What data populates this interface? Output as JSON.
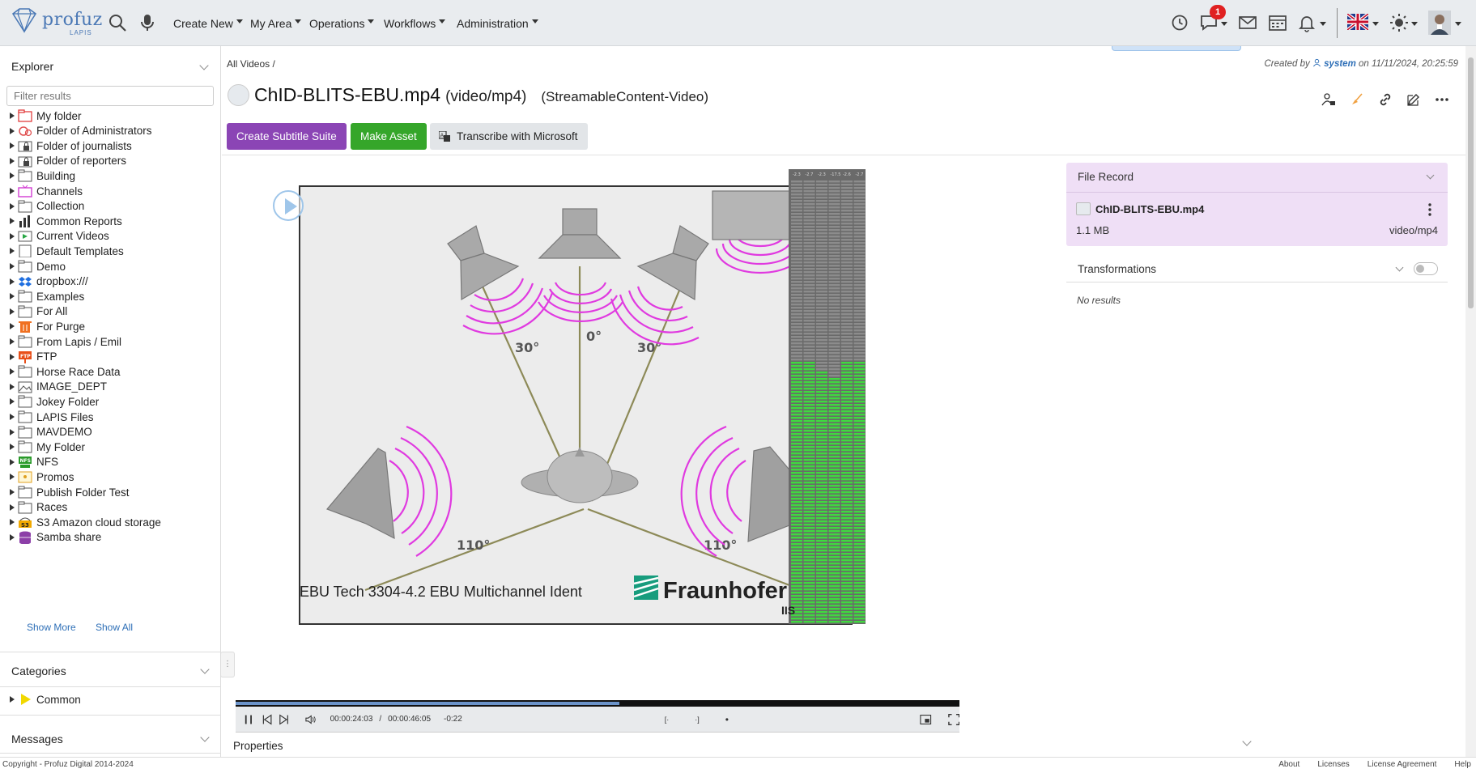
{
  "header": {
    "logo_text": "profuz",
    "logo_sub": "LAPIS",
    "menus": [
      "Create New",
      "My Area",
      "Operations",
      "Workflows",
      "Administration"
    ],
    "chat_badge": "1"
  },
  "sidebar": {
    "explorer_title": "Explorer",
    "filter_placeholder": "Filter results",
    "folders": [
      {
        "label": "My folder",
        "icon": "red-folder-icon"
      },
      {
        "label": "Folder of Administrators",
        "icon": "admin-folder-icon"
      },
      {
        "label": "Folder of journalists",
        "icon": "locked-folder-icon"
      },
      {
        "label": "Folder of reporters",
        "icon": "locked-folder-icon"
      },
      {
        "label": "Building",
        "icon": "folder-icon"
      },
      {
        "label": "Channels",
        "icon": "tv-icon"
      },
      {
        "label": "Collection",
        "icon": "folder-icon"
      },
      {
        "label": "Common Reports",
        "icon": "bar-chart-icon"
      },
      {
        "label": "Current Videos",
        "icon": "video-icon"
      },
      {
        "label": "Default Templates",
        "icon": "template-icon"
      },
      {
        "label": "Demo",
        "icon": "folder-icon"
      },
      {
        "label": "dropbox:///",
        "icon": "dropbox-icon"
      },
      {
        "label": "Examples",
        "icon": "folder-icon"
      },
      {
        "label": "For All",
        "icon": "folder-icon"
      },
      {
        "label": "For Purge",
        "icon": "trash-icon"
      },
      {
        "label": "From Lapis / Emil",
        "icon": "folder-icon"
      },
      {
        "label": "FTP",
        "icon": "ftp-icon"
      },
      {
        "label": "Horse Race Data",
        "icon": "folder-icon"
      },
      {
        "label": "IMAGE_DEPT",
        "icon": "image-icon"
      },
      {
        "label": "Jokey Folder",
        "icon": "folder-icon"
      },
      {
        "label": "LAPIS Files",
        "icon": "folder-icon"
      },
      {
        "label": "MAVDEMO",
        "icon": "folder-icon"
      },
      {
        "label": "My Folder",
        "icon": "folder-icon"
      },
      {
        "label": "NFS",
        "icon": "nfs-icon"
      },
      {
        "label": "Promos",
        "icon": "promo-icon"
      },
      {
        "label": "Publish Folder Test",
        "icon": "folder-icon"
      },
      {
        "label": "Races",
        "icon": "folder-icon"
      },
      {
        "label": "S3 Amazon cloud storage",
        "icon": "s3-icon"
      },
      {
        "label": "Samba share",
        "icon": "database-icon"
      }
    ],
    "show_more": "Show More",
    "show_all": "Show All",
    "categories_title": "Categories",
    "categories": [
      {
        "label": "Common",
        "icon": "yellow-triangle-icon"
      }
    ],
    "messages_title": "Messages"
  },
  "content": {
    "breadcrumb": "All Videos /",
    "created_prefix": "Created by",
    "created_user": "system",
    "created_suffix": "on 11/11/2024, 20:25:59",
    "file_name": "ChID-BLITS-EBU.mp4",
    "mime": "(video/mp4)",
    "content_type": "(StreamableContent-Video)",
    "buttons": {
      "subtitle": "Create Subtitle Suite",
      "asset": "Make Asset",
      "transcribe": "Transcribe with Microsoft"
    },
    "video": {
      "caption": "EBU Tech 3304-4.2 EBU Multichannel Ident",
      "brand": "Fraunhofer",
      "brand_sub": "IIS",
      "angles": [
        "30°",
        "0°",
        "30°",
        "110°",
        "110°"
      ],
      "meter_labels": [
        "-2.3",
        "-2.7",
        "-2.3",
        "-17.5",
        "-2.6",
        "-2.7"
      ],
      "time_current": "00:00:24:03",
      "time_sep": "/",
      "time_total": "00:00:46:05",
      "time_remaining": "-0:22",
      "progress": 0.53
    },
    "properties_title": "Properties"
  },
  "file_record": {
    "title": "File Record",
    "name": "ChID-BLITS-EBU.mp4",
    "size": "1.1 MB",
    "mime": "video/mp4",
    "transformations_title": "Transformations",
    "no_results": "No results"
  },
  "footer": {
    "copyright": "Copyright - Profuz Digital 2014-2024",
    "links": [
      "About",
      "Licenses",
      "License Agreement",
      "Help"
    ]
  }
}
